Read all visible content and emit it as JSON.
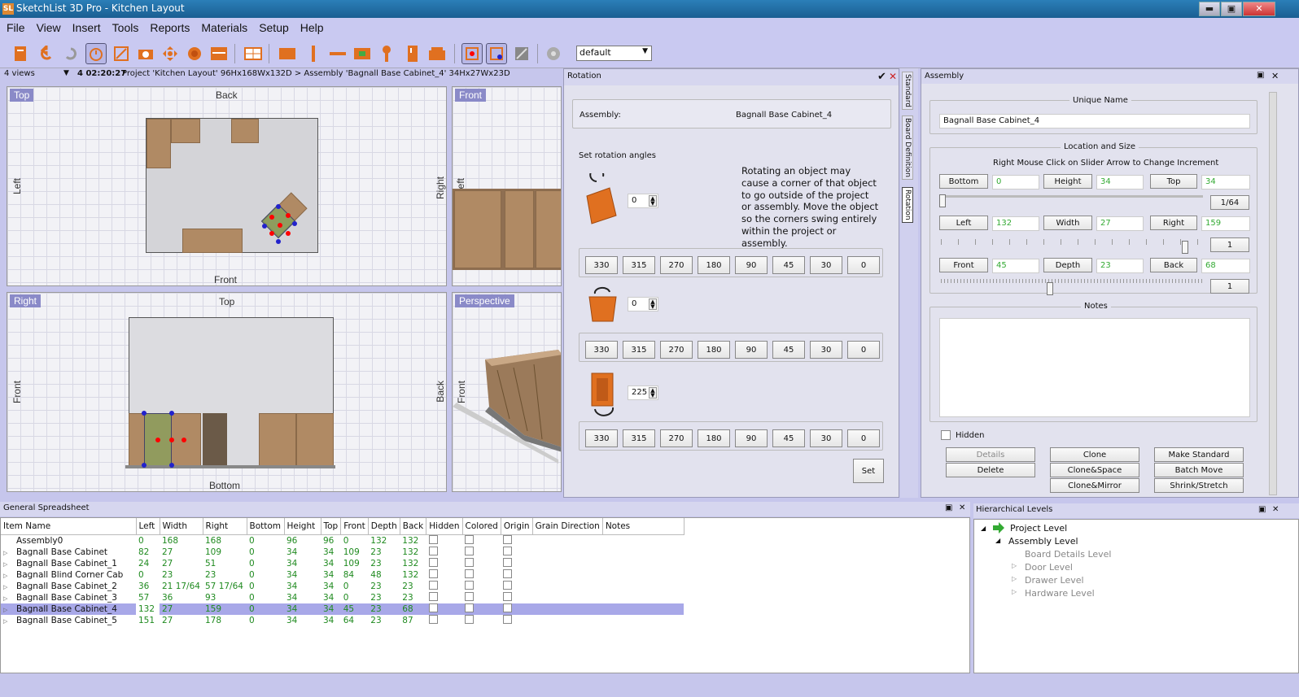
{
  "app": {
    "title": "SketchList 3D Pro - Kitchen Layout",
    "win_min": "▬",
    "win_max": "▣",
    "win_close": "✕"
  },
  "menu": [
    "File",
    "View",
    "Insert",
    "Tools",
    "Reports",
    "Materials",
    "Setup",
    "Help"
  ],
  "toolbar": {
    "preset": "default",
    "preset_arrow": "▼"
  },
  "status": {
    "views": "4 views",
    "views_arrow": "▼",
    "time": "4 02:20:27",
    "info": "Project 'Kitchen Layout' 96Hx168Wx132D > Assembly 'Bagnall Base Cabinet_4' 34Hx27Wx23D"
  },
  "views": {
    "top": {
      "label": "Top",
      "n": "Back",
      "s": "Front",
      "w": "Left",
      "e": "Right"
    },
    "front": {
      "label": "Front",
      "w": "Left"
    },
    "right": {
      "label": "Right",
      "n": "Top",
      "s": "Bottom",
      "w": "Front",
      "e": "Back"
    },
    "perspective": {
      "label": "Perspective",
      "w": "Front"
    }
  },
  "rotation": {
    "title": "Rotation",
    "ok": "✔",
    "close": "✕",
    "assembly_label": "Assembly:",
    "assembly_name": "Bagnall Base Cabinet_4",
    "set_angles": "Set rotation angles",
    "warning": "Rotating an object may cause a corner of that object to go outside of the project or assembly. Move the object so the corners swing entirely within the project or assembly.",
    "angles": [
      "0",
      "0",
      "225"
    ],
    "presets": [
      "330",
      "315",
      "270",
      "180",
      "90",
      "45",
      "30",
      "0"
    ],
    "set_button": "Set",
    "side_tabs": [
      "Standard",
      "Board Definition",
      "Rotation"
    ]
  },
  "assembly": {
    "title": "Assembly",
    "pin": "▣",
    "close": "✕",
    "unique_name_label": "Unique Name",
    "unique_name": "Bagnall Base Cabinet_4",
    "loc_size_label": "Location and Size",
    "hint": "Right Mouse Click on Slider Arrow to Change Increment",
    "rows": [
      {
        "a": "Bottom",
        "av": "0",
        "b": "Height",
        "bv": "34",
        "c": "Top",
        "cv": "34",
        "inc": "1/64"
      },
      {
        "a": "Left",
        "av": "132",
        "b": "Width",
        "bv": "27",
        "c": "Right",
        "cv": "159",
        "inc": "1"
      },
      {
        "a": "Front",
        "av": "45",
        "b": "Depth",
        "bv": "23",
        "c": "Back",
        "cv": "68",
        "inc": "1"
      }
    ],
    "notes_label": "Notes",
    "hidden_label": "Hidden",
    "buttons": [
      "Details",
      "Clone",
      "Make Standard",
      "Delete",
      "Clone&Space",
      "Batch Move",
      "Clone&Mirror",
      "Shrink/Stretch"
    ]
  },
  "spreadsheet": {
    "title": "General Spreadsheet",
    "pin": "▣",
    "close": "✕",
    "columns": [
      "Item Name",
      "Left",
      "Width",
      "Right",
      "Bottom",
      "Height",
      "Top",
      "Front",
      "Depth",
      "Back",
      "Hidden",
      "Colored",
      "Origin",
      "Grain Direction",
      "Notes"
    ],
    "rows": [
      {
        "name": "Assembly0",
        "v": [
          "0",
          "168",
          "168",
          "0",
          "96",
          "96",
          "0",
          "132",
          "132"
        ]
      },
      {
        "name": "Bagnall Base Cabinet",
        "v": [
          "82",
          "27",
          "109",
          "0",
          "34",
          "34",
          "109",
          "23",
          "132"
        ]
      },
      {
        "name": "Bagnall Base Cabinet_1",
        "v": [
          "24",
          "27",
          "51",
          "0",
          "34",
          "34",
          "109",
          "23",
          "132"
        ]
      },
      {
        "name": "Bagnall Blind Corner Cab",
        "v": [
          "0",
          "23",
          "23",
          "0",
          "34",
          "34",
          "84",
          "48",
          "132"
        ]
      },
      {
        "name": "Bagnall Base Cabinet_2",
        "v": [
          "36",
          "21 17/64",
          "57 17/64",
          "0",
          "34",
          "34",
          "0",
          "23",
          "23"
        ]
      },
      {
        "name": "Bagnall Base Cabinet_3",
        "v": [
          "57",
          "36",
          "93",
          "0",
          "34",
          "34",
          "0",
          "23",
          "23"
        ]
      },
      {
        "name": "Bagnall Base Cabinet_4",
        "v": [
          "132",
          "27",
          "159",
          "0",
          "34",
          "34",
          "45",
          "23",
          "68"
        ]
      },
      {
        "name": "Bagnall Base Cabinet_5",
        "v": [
          "151",
          "27",
          "178",
          "0",
          "34",
          "34",
          "64",
          "23",
          "87"
        ]
      }
    ]
  },
  "hierarchy": {
    "title": "Hierarchical Levels",
    "pin": "▣",
    "close": "✕",
    "items": [
      "Project Level",
      "Assembly Level",
      "Board Details Level",
      "Door Level",
      "Drawer Level",
      "Hardware Level"
    ]
  },
  "colors": {
    "bg": "#c6c6ec",
    "accent": "#8a8ac8",
    "selected_row": "#a8a8e8",
    "value_green": "#1f8a1f"
  }
}
